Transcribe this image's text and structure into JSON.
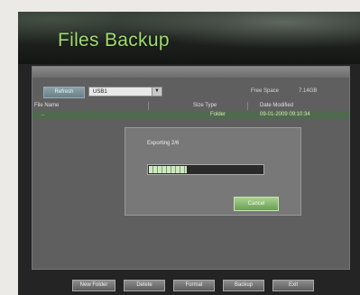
{
  "app": {
    "title": "Files Backup"
  },
  "toolbar": {
    "refresh_label": "Refresh",
    "device_value": "USB1",
    "free_space_label": "Free Space",
    "free_space_value": "7.14GB"
  },
  "table": {
    "columns": [
      "File Name",
      "Size Type",
      "Date Modified"
    ],
    "rows": [
      {
        "name": "..",
        "type": "Folder",
        "date": "09-01-2009 09:10:34"
      }
    ]
  },
  "dialog": {
    "message": "Exporting 2/6",
    "progress_fraction": 0.33,
    "cancel_label": "Cancel"
  },
  "buttons": {
    "new_folder": "New Folder",
    "delete": "Delete",
    "format": "Format",
    "backup": "Backup",
    "exit": "Exit"
  },
  "colors": {
    "title": "#9fdc6c",
    "accent": "#6b9e55",
    "selected_row": "#4f6a4f"
  }
}
